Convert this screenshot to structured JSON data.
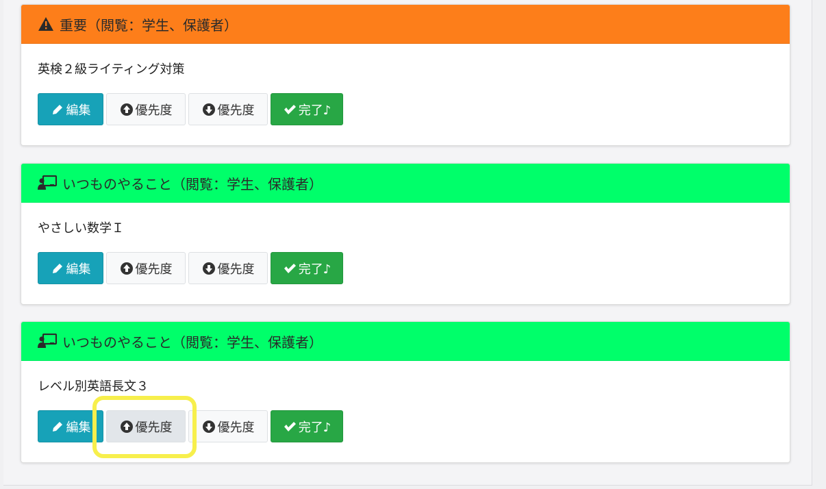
{
  "colors": {
    "important_header": "#fd7e1a",
    "routine_header": "#00ff6a",
    "edit_button": "#17a2b8",
    "done_button": "#28a745",
    "highlight": "#f7ef4c"
  },
  "cards": [
    {
      "header_icon": "warning-icon",
      "header_title": "重要（閲覧：学生、保護者）",
      "item_title": "英検２級ライティング対策",
      "buttons": {
        "edit": "編集",
        "priority_up": "優先度",
        "priority_down": "優先度",
        "done": "完了♪"
      }
    },
    {
      "header_icon": "teacher-board-icon",
      "header_title": "いつものやること（閲覧：学生、保護者）",
      "item_title": "やさしい数学Ｉ",
      "buttons": {
        "edit": "編集",
        "priority_up": "優先度",
        "priority_down": "優先度",
        "done": "完了♪"
      }
    },
    {
      "header_icon": "teacher-board-icon",
      "header_title": "いつものやること（閲覧：学生、保護者）",
      "item_title": "レベル別英語長文３",
      "buttons": {
        "edit": "編集",
        "priority_up": "優先度",
        "priority_down": "優先度",
        "done": "完了♪"
      }
    }
  ]
}
